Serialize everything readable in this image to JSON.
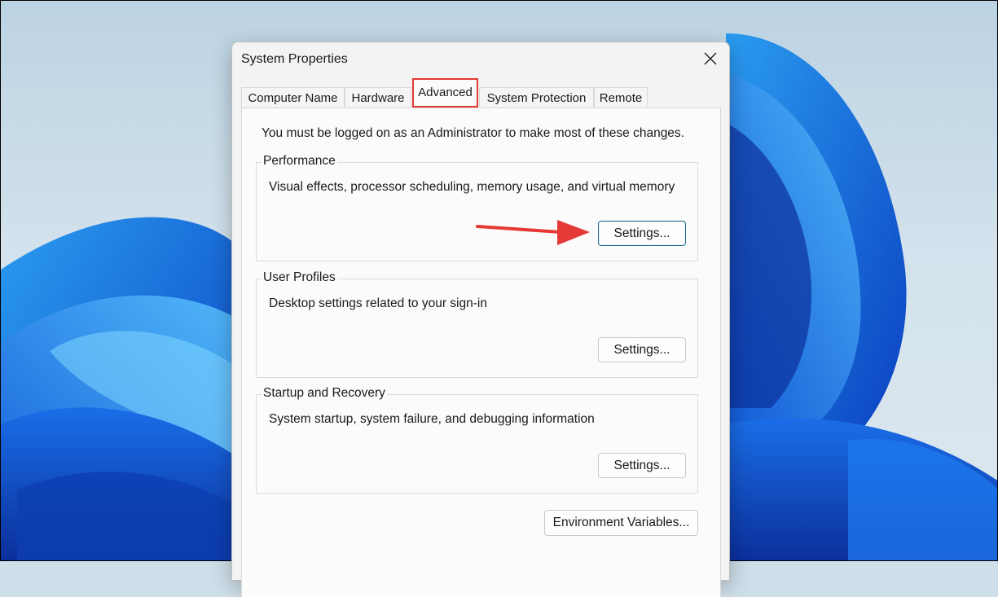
{
  "window": {
    "title": "System Properties",
    "close_icon": "close-icon"
  },
  "tabs": [
    {
      "label": "Computer Name",
      "active": false
    },
    {
      "label": "Hardware",
      "active": false
    },
    {
      "label": "Advanced",
      "active": true
    },
    {
      "label": "System Protection",
      "active": false
    },
    {
      "label": "Remote",
      "active": false
    }
  ],
  "advanced": {
    "admin_note": "You must be logged on as an Administrator to make most of these changes.",
    "performance": {
      "label": "Performance",
      "description": "Visual effects, processor scheduling, memory usage, and virtual memory",
      "button": "Settings..."
    },
    "user_profiles": {
      "label": "User Profiles",
      "description": "Desktop settings related to your sign-in",
      "button": "Settings..."
    },
    "startup_recovery": {
      "label": "Startup and Recovery",
      "description": "System startup, system failure, and debugging information",
      "button": "Settings..."
    },
    "env_button": "Environment Variables..."
  },
  "annotations": {
    "highlight_color": "#e53935",
    "arrow_color": "#e53935",
    "arrow_icon": "red-arrow-icon"
  },
  "colors": {
    "wallpaper_accent": "#1565e0",
    "dialog_bg": "#f3f3f3",
    "focus_border": "#1f6a8a"
  }
}
